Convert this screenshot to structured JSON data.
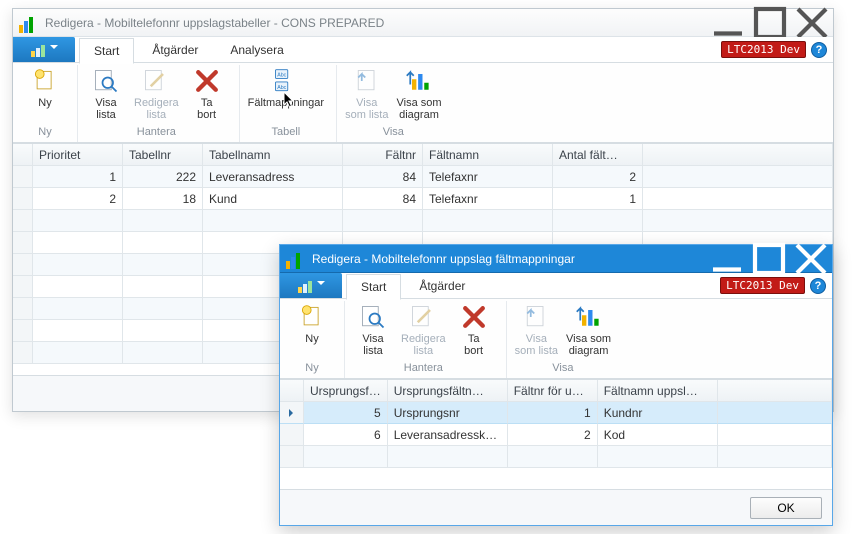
{
  "main_window": {
    "title": "Redigera - Mobiltelefonnr uppslagstabeller - CONS PREPARED",
    "badge": "LTC2013 Dev",
    "tabs": {
      "start": "Start",
      "actions": "Åtgärder",
      "analyse": "Analysera"
    },
    "ribbon": {
      "groups": {
        "ny": {
          "label": "Ny",
          "new": "Ny"
        },
        "hantera": {
          "label": "Hantera",
          "visa_lista": "Visa\nlista",
          "redigera_lista": "Redigera\nlista",
          "ta_bort": "Ta\nbort"
        },
        "tabell": {
          "label": "Tabell",
          "faltmappningar": "Fältmappningar"
        },
        "visa": {
          "label": "Visa",
          "visa_som_lista": "Visa\nsom lista",
          "visa_som_diagram": "Visa som\ndiagram"
        }
      }
    },
    "columns": {
      "prioritet": "Prioritet",
      "tabellnr": "Tabellnr",
      "tabellnamn": "Tabellnamn",
      "faltnr": "Fältnr",
      "faltnamn": "Fältnamn",
      "antal": "Antal fält…"
    },
    "rows": [
      {
        "prioritet": "1",
        "tabellnr": "222",
        "tabellnamn": "Leveransadress",
        "faltnr": "84",
        "faltnamn": "Telefaxnr",
        "antal": "2"
      },
      {
        "prioritet": "2",
        "tabellnr": "18",
        "tabellnamn": "Kund",
        "faltnr": "84",
        "faltnamn": "Telefaxnr",
        "antal": "1"
      }
    ]
  },
  "sub_window": {
    "title": "Redigera - Mobiltelefonnr uppslag fältmappningar",
    "badge": "LTC2013 Dev",
    "tabs": {
      "start": "Start",
      "actions": "Åtgärder"
    },
    "ribbon": {
      "groups": {
        "ny": {
          "label": "Ny",
          "new": "Ny"
        },
        "hantera": {
          "label": "Hantera",
          "visa_lista": "Visa\nlista",
          "redigera_lista": "Redigera\nlista",
          "ta_bort": "Ta\nbort"
        },
        "visa": {
          "label": "Visa",
          "visa_som_lista": "Visa\nsom lista",
          "visa_som_diagram": "Visa som\ndiagram"
        }
      }
    },
    "columns": {
      "ursprf": "Ursprungsf…",
      "ursprfn": "Ursprungsfältn…",
      "faltnru": "Fältnr för u…",
      "faltnamnu": "Fältnamn uppsl…"
    },
    "rows": [
      {
        "ursprf": "5",
        "ursprfn": "Ursprungsnr",
        "faltnru": "1",
        "faltnamnu": "Kundnr"
      },
      {
        "ursprf": "6",
        "ursprfn": "Leveransadressk…",
        "faltnru": "2",
        "faltnamnu": "Kod"
      }
    ],
    "ok": "OK"
  }
}
